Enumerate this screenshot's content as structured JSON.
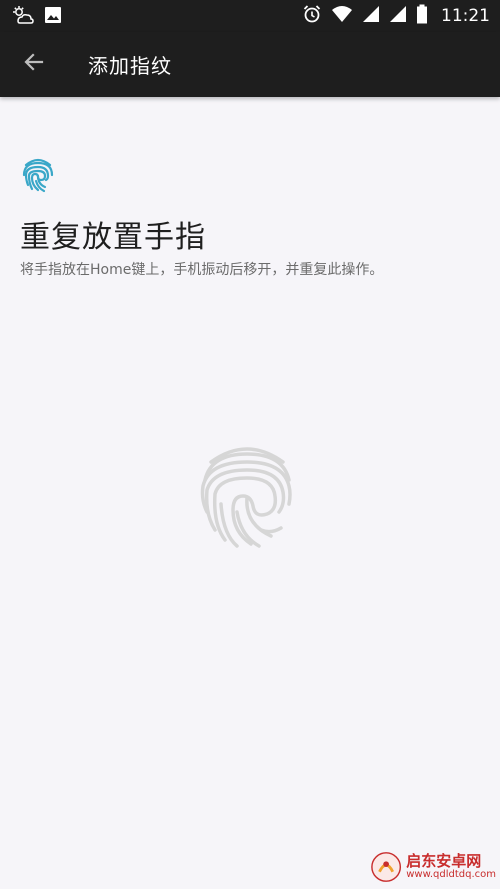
{
  "status_bar": {
    "time": "11:21",
    "icons_left": [
      "weather-icon",
      "image-icon"
    ],
    "icons_right": [
      "alarm-icon",
      "wifi-icon",
      "signal-icon",
      "signal-icon",
      "battery-icon"
    ]
  },
  "toolbar": {
    "title": "添加指纹",
    "back_icon": "arrow-left-icon"
  },
  "content": {
    "heading": "重复放置手指",
    "instruction": "将手指放在Home键上，手机振动后移开，并重复此操作。",
    "header_icon": "fingerprint-icon"
  },
  "watermark": {
    "name": "启东安卓网",
    "url": "www.qdldtdq.com"
  },
  "colors": {
    "bar_background": "#1e1e1e",
    "page_background": "#f6f5f9",
    "fingerprint_accent": "#3aa7c8",
    "sensor_gray": "#d6d6d6",
    "watermark_red": "#c82d2d"
  }
}
